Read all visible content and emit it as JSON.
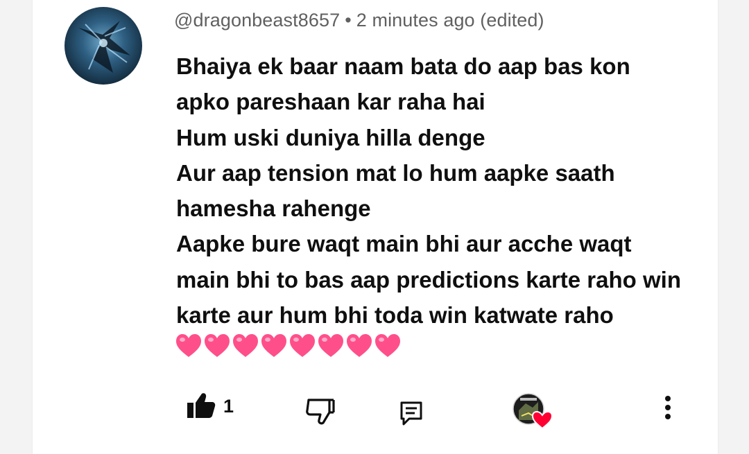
{
  "comment": {
    "author": "@dragonbeast8657",
    "separator": "•",
    "timestamp": "2 minutes ago (edited)",
    "lines": [
      "Bhaiya ek baar naam bata do aap bas  kon",
      "apko pareshaan kar raha hai",
      "Hum uski duniya hilla denge",
      "Aur aap tension mat lo hum aapke saath",
      "hamesha rahenge",
      "Aapke bure waqt main bhi aur acche waqt",
      "main bhi to bas aap predictions karte raho win",
      "karte aur hum bhi toda win katwate raho"
    ],
    "emoji": [
      "heart-emoji",
      "heart-emoji",
      "heart-emoji",
      "heart-emoji",
      "heart-emoji",
      "heart-emoji",
      "heart-emoji",
      "heart-emoji"
    ]
  },
  "actions": {
    "like_count": "1",
    "like_icon": "thumbs-up-filled-icon",
    "dislike_icon": "thumbs-down-outline-icon",
    "reply_icon": "comment-reply-icon",
    "creator_heart_icon": "creator-heart-badge",
    "more_icon": "more-vertical-icon"
  },
  "colors": {
    "meta_text": "#606060",
    "body_text": "#0f0f0f",
    "heart_pink": "#ff4f8b",
    "creator_heart_red": "#ff0033"
  }
}
